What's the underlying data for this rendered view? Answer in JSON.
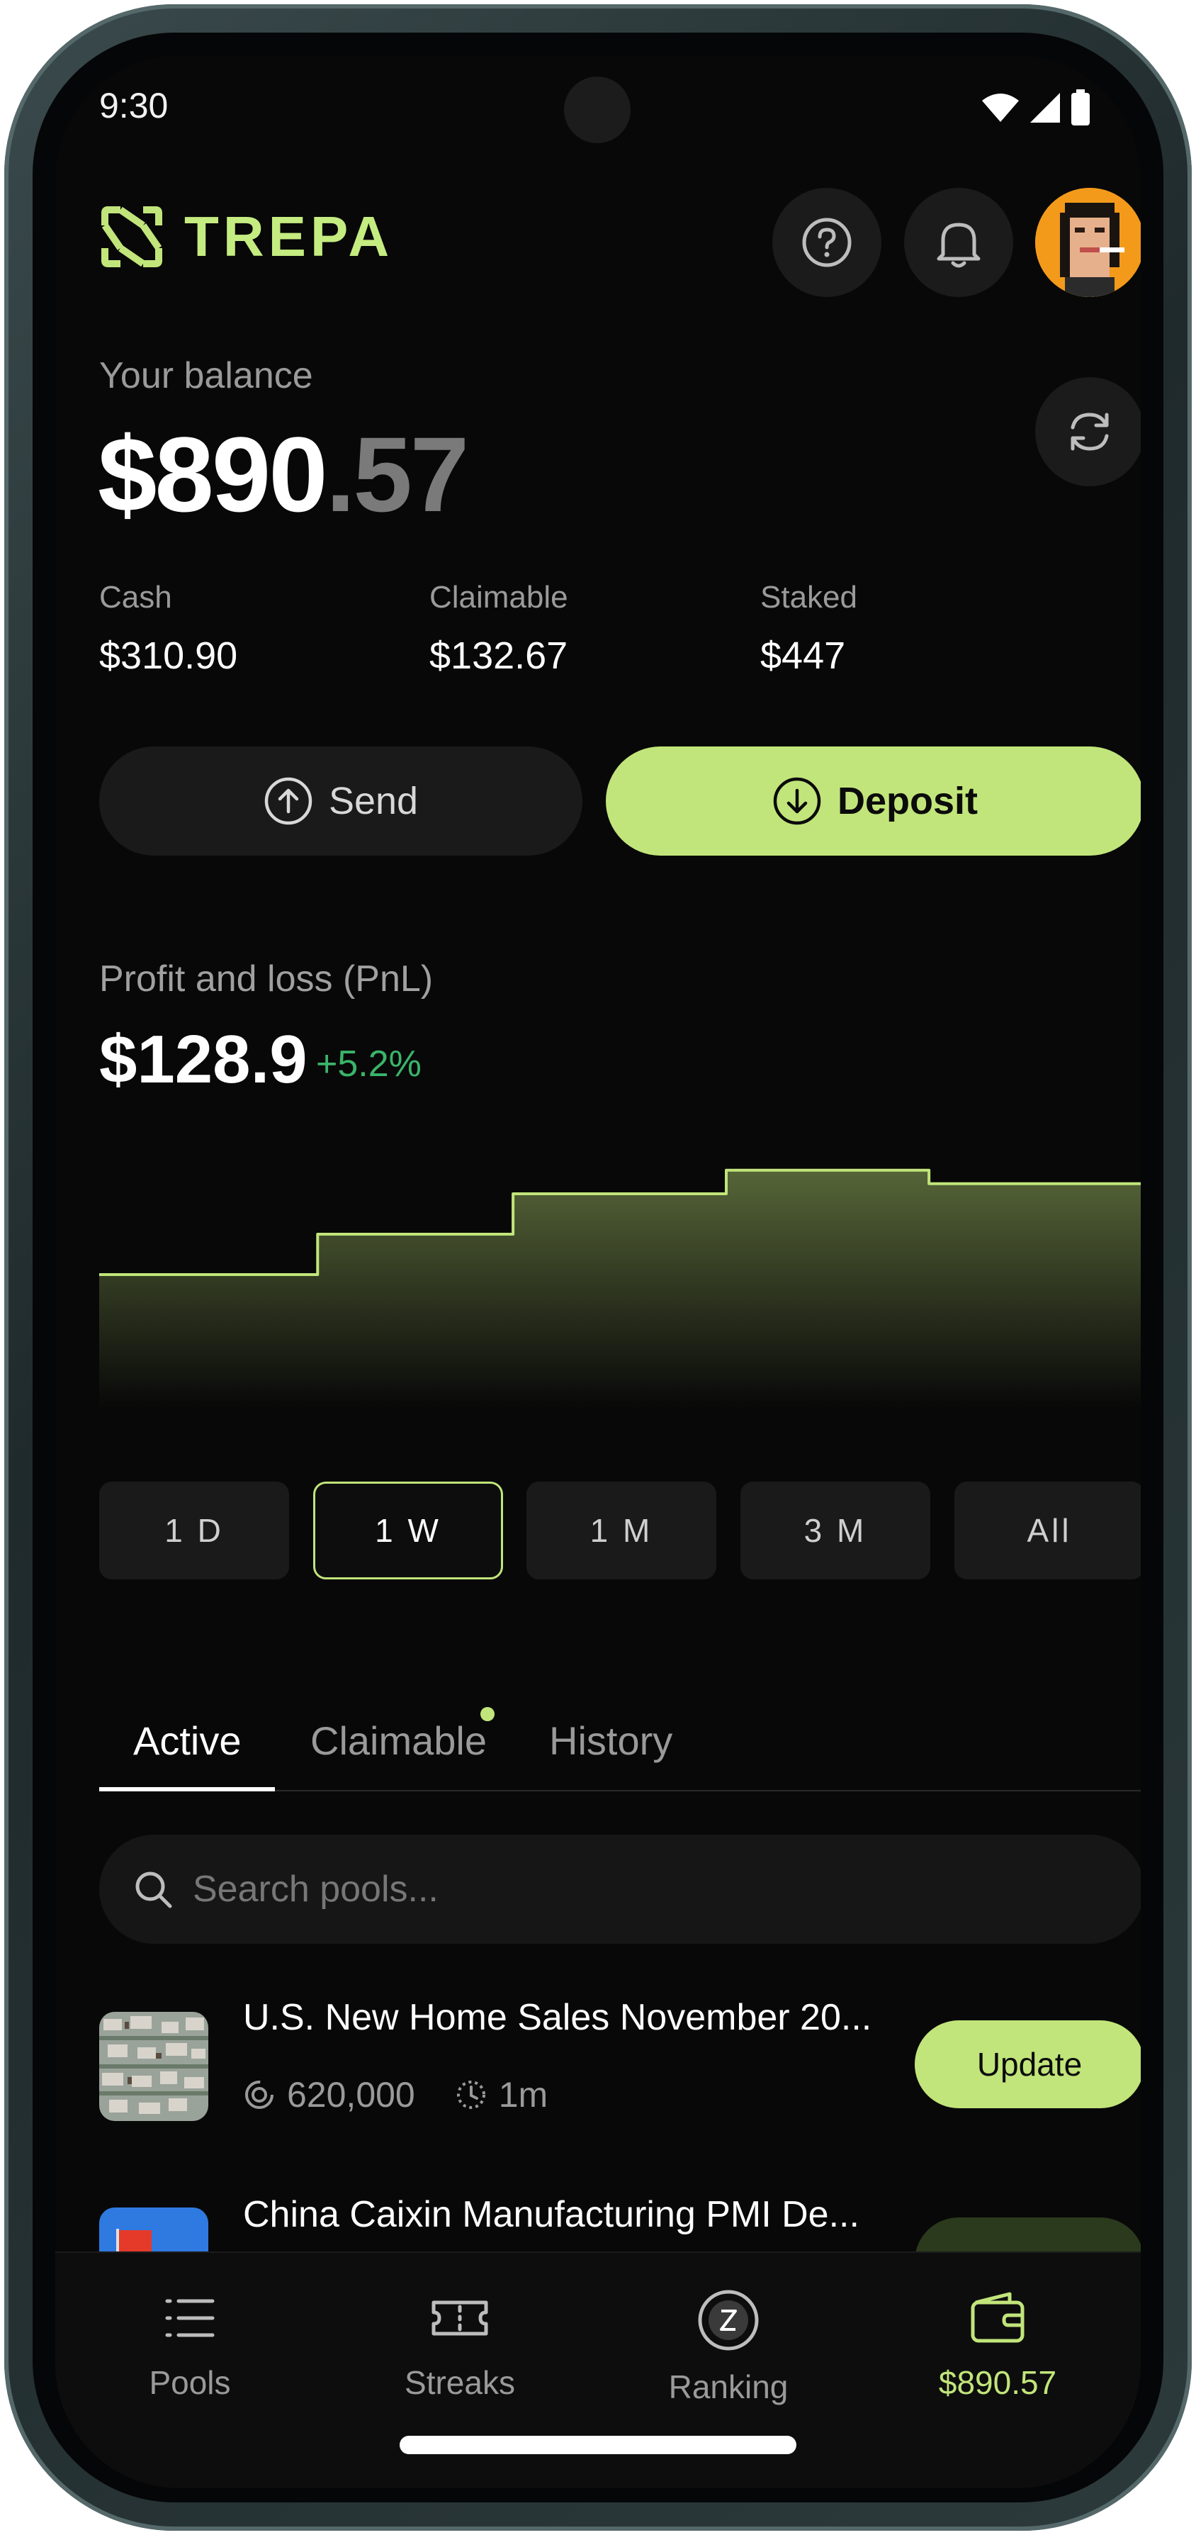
{
  "status_bar": {
    "time": "9:30"
  },
  "header": {
    "logo_text": "TREPA",
    "help_icon": "question-circle-icon",
    "notifications_icon": "bell-icon",
    "avatar": "pixel-art-avatar"
  },
  "balance": {
    "label": "Your balance",
    "whole": "$890",
    "cents": ".57",
    "refresh_icon": "refresh-icon",
    "breakdown": [
      {
        "label": "Cash",
        "value": "$310.90"
      },
      {
        "label": "Claimable",
        "value": "$132.67"
      },
      {
        "label": "Staked",
        "value": "$447"
      }
    ]
  },
  "actions": {
    "send_label": "Send",
    "deposit_label": "Deposit"
  },
  "pnl": {
    "label": "Profit and loss (PnL)",
    "value": "$128.9",
    "change": "+5.2%"
  },
  "chart_data": {
    "type": "area",
    "step": true,
    "values": [
      40,
      52,
      64,
      71,
      67
    ],
    "ylim": [
      0,
      80
    ],
    "color": "#c1e57a"
  },
  "ranges": [
    {
      "label": "1 D",
      "selected": false
    },
    {
      "label": "1 W",
      "selected": true
    },
    {
      "label": "1 M",
      "selected": false
    },
    {
      "label": "3 M",
      "selected": false
    },
    {
      "label": "All",
      "selected": false
    }
  ],
  "tabs": [
    {
      "label": "Active",
      "active": true
    },
    {
      "label": "Claimable",
      "active": false,
      "has_dot": true
    },
    {
      "label": "History",
      "active": false
    }
  ],
  "search": {
    "placeholder": "Search pools..."
  },
  "pools": [
    {
      "title": "U.S. New Home Sales November 20...",
      "volume": "620,000",
      "time": "1m",
      "action": "Update"
    },
    {
      "title": "China Caixin Manufacturing PMI De..."
    }
  ],
  "bottom_nav": [
    {
      "label": "Pools",
      "icon": "list-icon",
      "active": false
    },
    {
      "label": "Streaks",
      "icon": "ticket-icon",
      "active": false
    },
    {
      "label": "Ranking",
      "icon": "ranking-badge-icon",
      "active": false
    },
    {
      "label": "$890.57",
      "icon": "wallet-icon",
      "active": true
    }
  ],
  "colors": {
    "accent": "#c1e57a",
    "positive": "#3ab46a",
    "background": "#080808"
  }
}
